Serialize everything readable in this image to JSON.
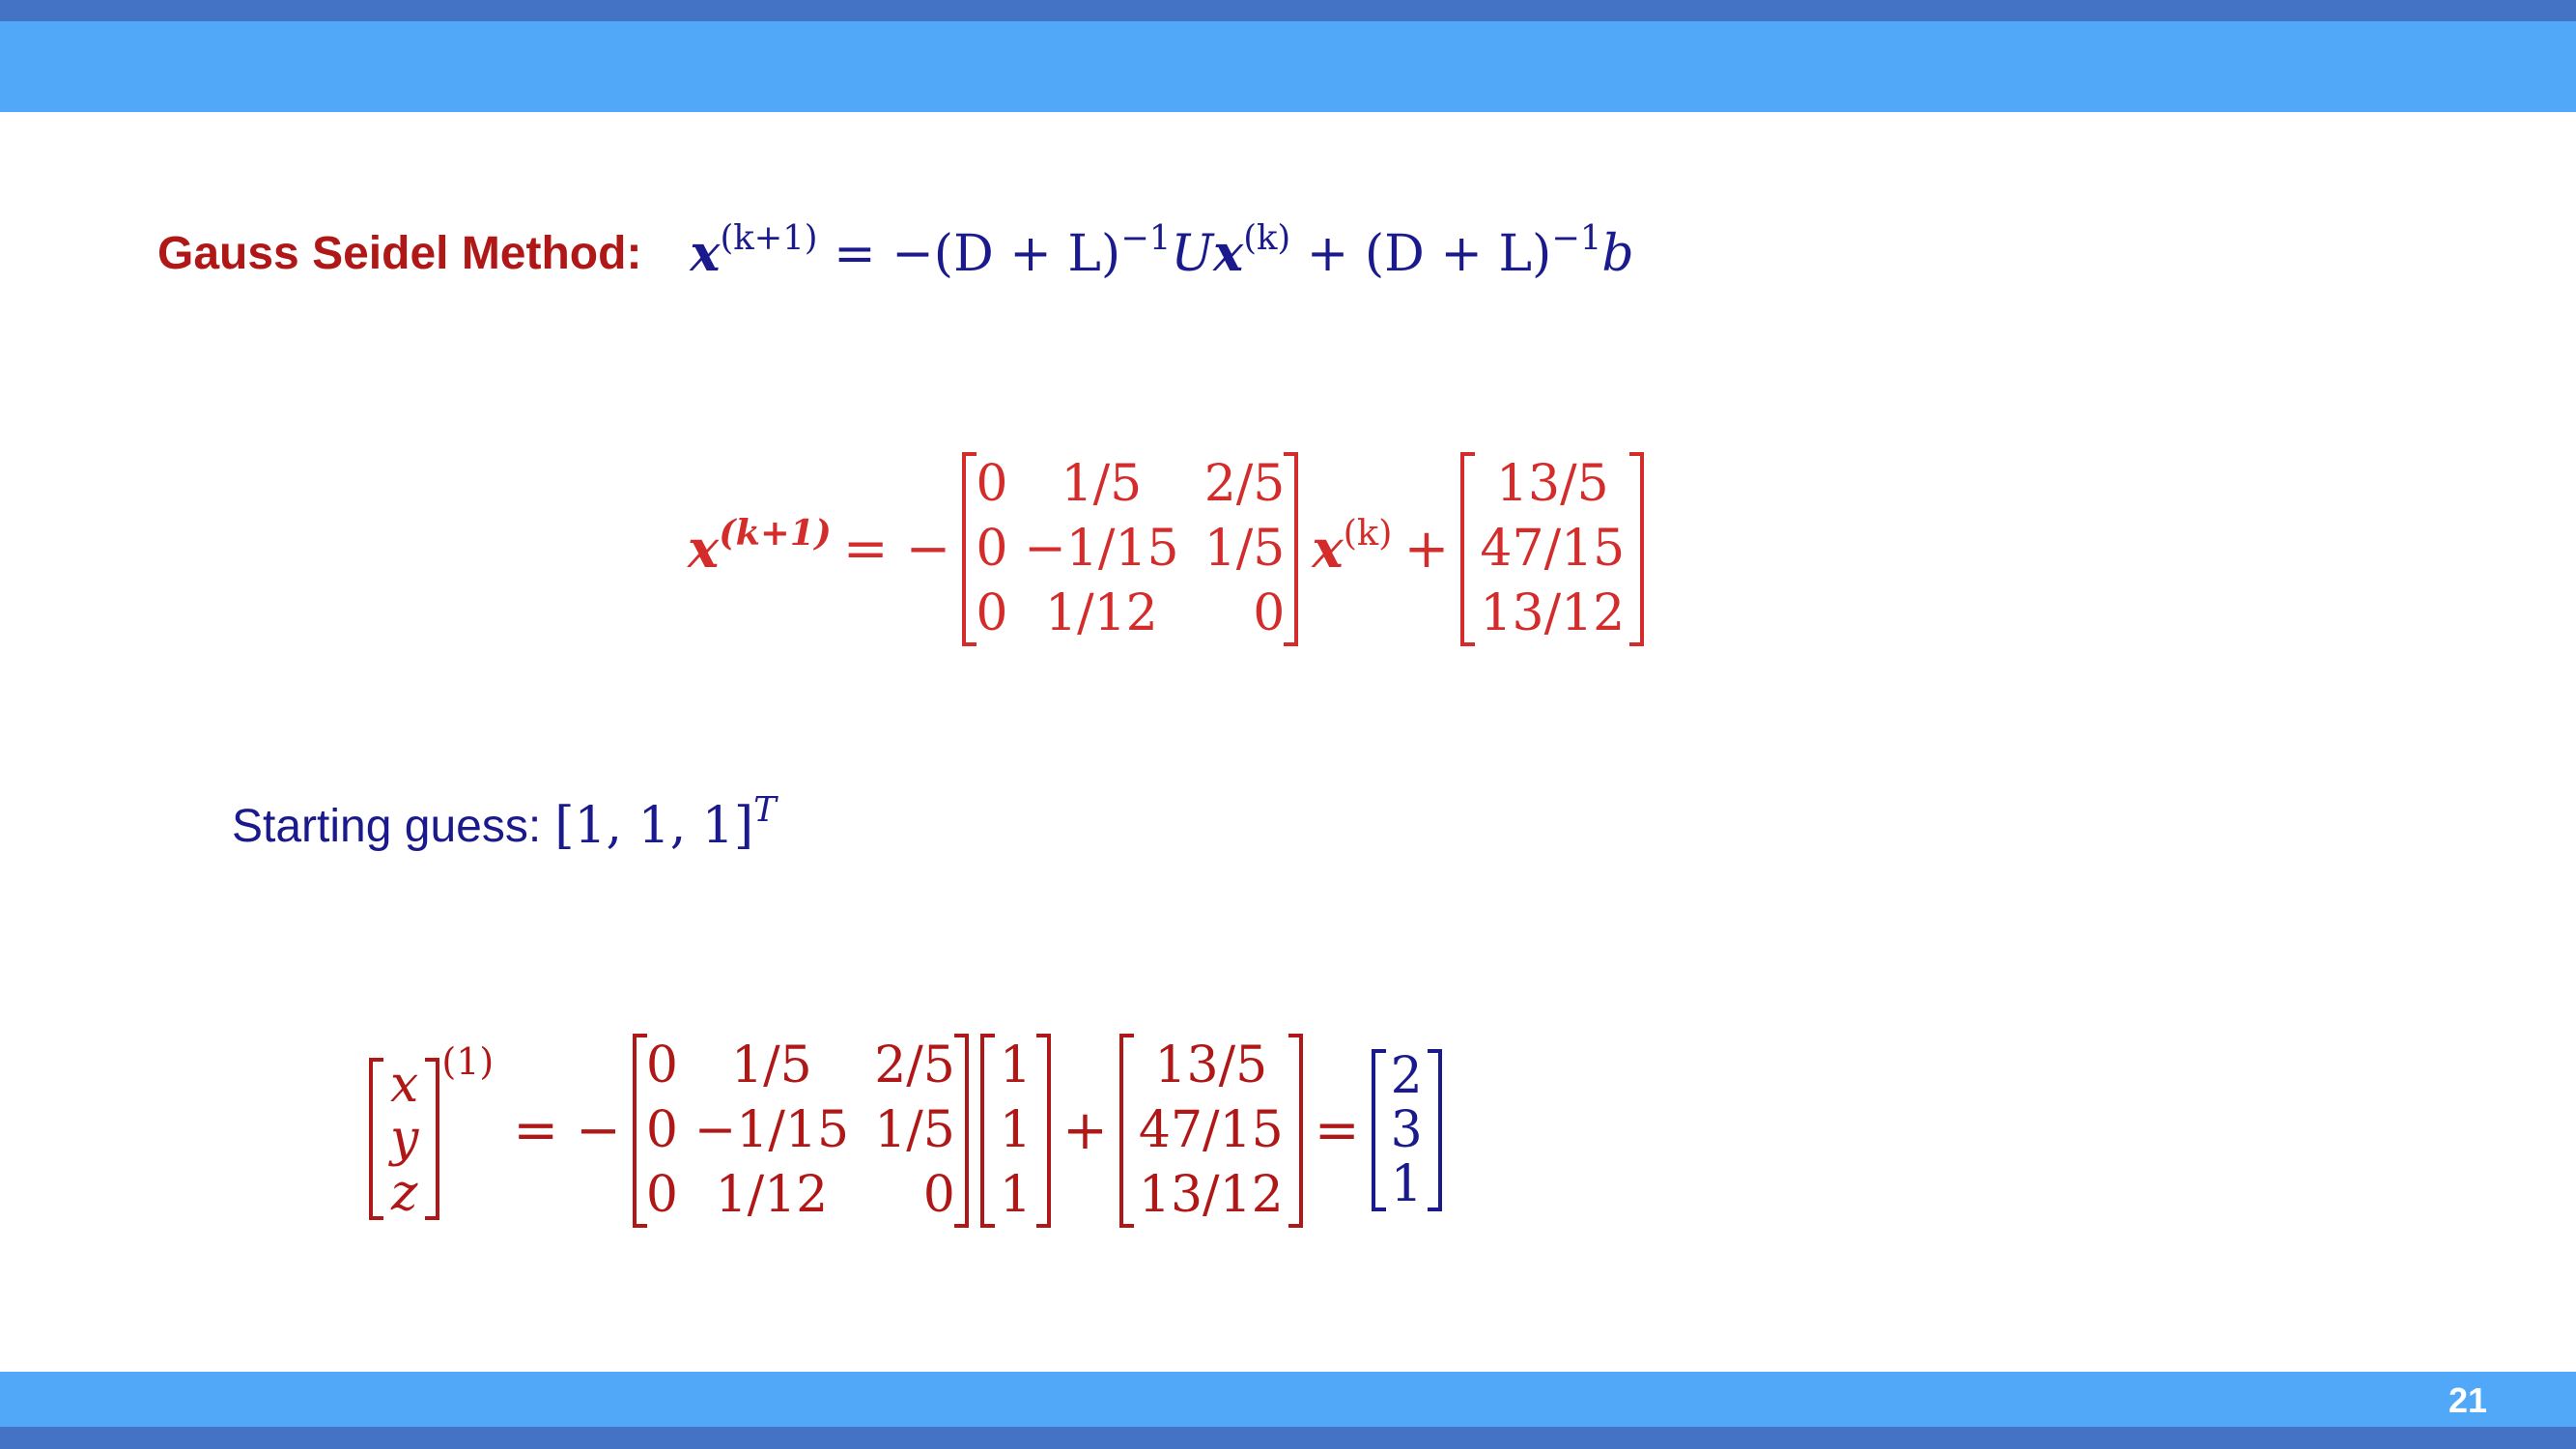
{
  "slide": {
    "page_number": "21"
  },
  "title": {
    "label": "Gauss Seidel Method:",
    "formula_parts": {
      "x": "x",
      "sup_k1": "(k+1)",
      "eq": "= −(D + L)",
      "inv1": "−1",
      "U": "U",
      "x2": "x",
      "sup_k": "(k)",
      "plus": "+ (D + L)",
      "inv2": "−1",
      "b": "b"
    }
  },
  "iteration": {
    "lhs": "x",
    "lhs_sup": "(k+1)",
    "equals_minus": "= −",
    "matrix": [
      [
        "0",
        "1/5",
        "2/5"
      ],
      [
        "0",
        "−1/15",
        "1/5"
      ],
      [
        "0",
        "1/12",
        "0"
      ]
    ],
    "x": "x",
    "x_sup": "(k)",
    "plus": "+",
    "vector": [
      "13/5",
      "47/15",
      "13/12"
    ]
  },
  "start": {
    "label": "Starting guess:",
    "value": "[1, 1, 1]",
    "sup": "T"
  },
  "step": {
    "lhs_vector": [
      "x",
      "y",
      "z"
    ],
    "lhs_sup": "(1)",
    "equals_minus": "= −",
    "matrix": [
      [
        "0",
        "1/5",
        "2/5"
      ],
      [
        "0",
        "−1/15",
        "1/5"
      ],
      [
        "0",
        "1/12",
        "0"
      ]
    ],
    "guess": [
      "1",
      "1",
      "1"
    ],
    "plus": "+",
    "vector": [
      "13/5",
      "47/15",
      "13/12"
    ],
    "equals": "=",
    "result": [
      "2",
      "3",
      "1"
    ]
  }
}
